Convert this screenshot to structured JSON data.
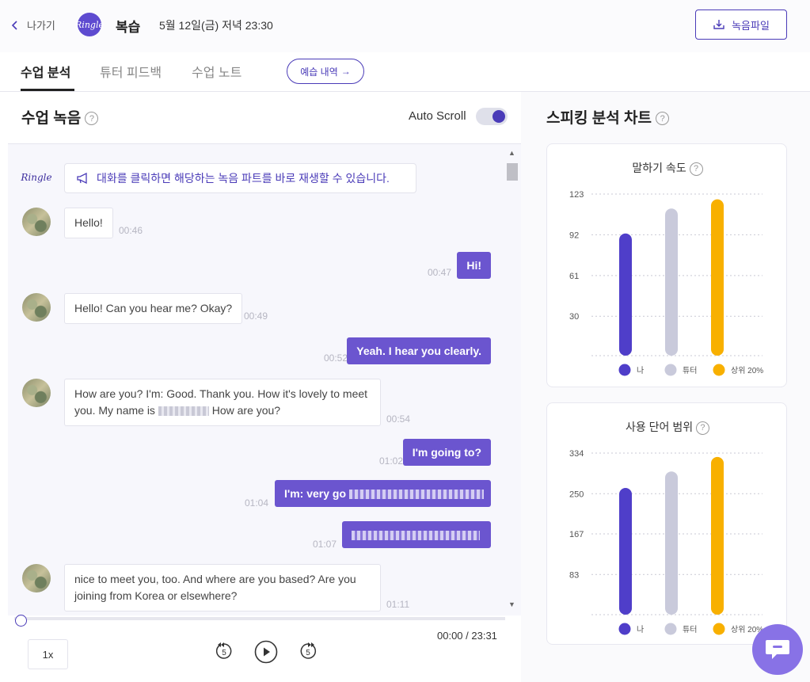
{
  "header": {
    "back_label": "나가기",
    "logo_text": "Ringle",
    "title": "복습",
    "date": "5월 12일(금) 저녁 23:30",
    "record_button": "녹음파일"
  },
  "tabs": [
    {
      "label": "수업 분석",
      "active": true
    },
    {
      "label": "튜터 피드백",
      "active": false
    },
    {
      "label": "수업 노트",
      "active": false
    }
  ],
  "prep_button": "예습 내역",
  "recording": {
    "title": "수업 녹음",
    "auto_scroll_label": "Auto Scroll",
    "auto_scroll_on": true,
    "notice": "대화를 클릭하면 해당하는 녹음 파트를 바로 재생할 수 있습니다.",
    "messages": [
      {
        "speaker": "tutor",
        "text": "Hello!",
        "time": "00:46"
      },
      {
        "speaker": "me",
        "text": "Hi!",
        "time": "00:47"
      },
      {
        "speaker": "tutor",
        "text": "Hello! Can you hear me? Okay?",
        "time": "00:49"
      },
      {
        "speaker": "me",
        "text": "Yeah. I hear you clearly.",
        "time": "00:52"
      },
      {
        "speaker": "tutor",
        "text_a": "How are you? I'm: Good. Thank you. How it's lovely to meet you. My name is",
        "text_b": "How are you?",
        "time": "00:54"
      },
      {
        "speaker": "me",
        "text": "I'm going to?",
        "time": "01:02"
      },
      {
        "speaker": "me",
        "text": "I'm: very go",
        "time": "01:04"
      },
      {
        "speaker": "me",
        "text": "",
        "time": "01:07"
      },
      {
        "speaker": "tutor",
        "text": "nice to meet you, too. And where are you based? Are you joining from Korea or elsewhere?",
        "time": "01:11"
      }
    ]
  },
  "player": {
    "progress": 0,
    "time_display": "00:00 / 23:31",
    "speed": "1x",
    "rewind_seconds": "5",
    "forward_seconds": "5"
  },
  "analysis": {
    "title": "스피킹 분석 차트"
  },
  "chart_data": [
    {
      "type": "bar",
      "title": "말하기 속도",
      "categories": [
        "나",
        "튜터",
        "상위 20%"
      ],
      "values": [
        93,
        112,
        119
      ],
      "yticks": [
        30,
        61,
        92,
        123
      ],
      "ylim": [
        0,
        123
      ],
      "grid": true,
      "legend": "bottom",
      "colors": [
        "#4f3ec9",
        "#c9cadb",
        "#f8b000"
      ]
    },
    {
      "type": "bar",
      "title": "사용 단어 범위",
      "categories": [
        "나",
        "튜터",
        "상위 20%"
      ],
      "values": [
        262,
        296,
        326
      ],
      "yticks": [
        83,
        167,
        250,
        334
      ],
      "ylim": [
        0,
        334
      ],
      "grid": true,
      "legend": "bottom",
      "colors": [
        "#4f3ec9",
        "#c9cadb",
        "#f8b000"
      ]
    }
  ]
}
